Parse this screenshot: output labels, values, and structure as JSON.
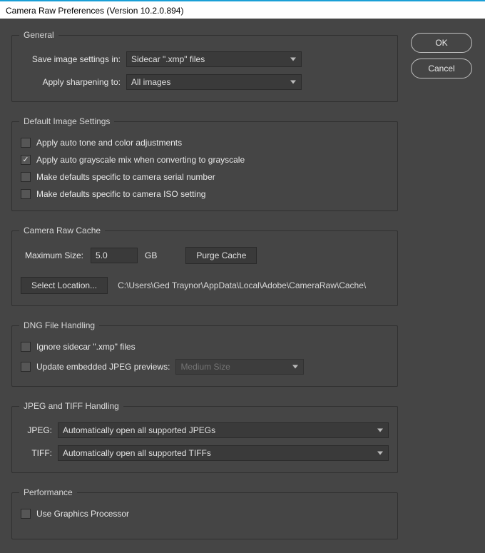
{
  "title": "Camera Raw Preferences  (Version 10.2.0.894)",
  "buttons": {
    "ok": "OK",
    "cancel": "Cancel"
  },
  "general": {
    "legend": "General",
    "saveLabel": "Save image settings in:",
    "saveValue": "Sidecar \".xmp\" files",
    "sharpenLabel": "Apply sharpening to:",
    "sharpenValue": "All images"
  },
  "defaults": {
    "legend": "Default Image Settings",
    "autoTone": "Apply auto tone and color adjustments",
    "autoGray": "Apply auto grayscale mix when converting to grayscale",
    "specificSerial": "Make defaults specific to camera serial number",
    "specificISO": "Make defaults specific to camera ISO setting"
  },
  "cache": {
    "legend": "Camera Raw Cache",
    "maxLabel": "Maximum Size:",
    "maxValue": "5.0",
    "maxUnit": "GB",
    "purge": "Purge Cache",
    "selectLoc": "Select Location...",
    "path": "C:\\Users\\Ged Traynor\\AppData\\Local\\Adobe\\CameraRaw\\Cache\\"
  },
  "dng": {
    "legend": "DNG File Handling",
    "ignoreXmp": "Ignore sidecar \".xmp\" files",
    "updatePreviews": "Update embedded JPEG previews:",
    "previewSize": "Medium Size"
  },
  "jpegTiff": {
    "legend": "JPEG and TIFF Handling",
    "jpegLabel": "JPEG:",
    "jpegValue": "Automatically open all supported JPEGs",
    "tiffLabel": "TIFF:",
    "tiffValue": "Automatically open all supported TIFFs"
  },
  "perf": {
    "legend": "Performance",
    "useGPU": "Use Graphics Processor"
  }
}
